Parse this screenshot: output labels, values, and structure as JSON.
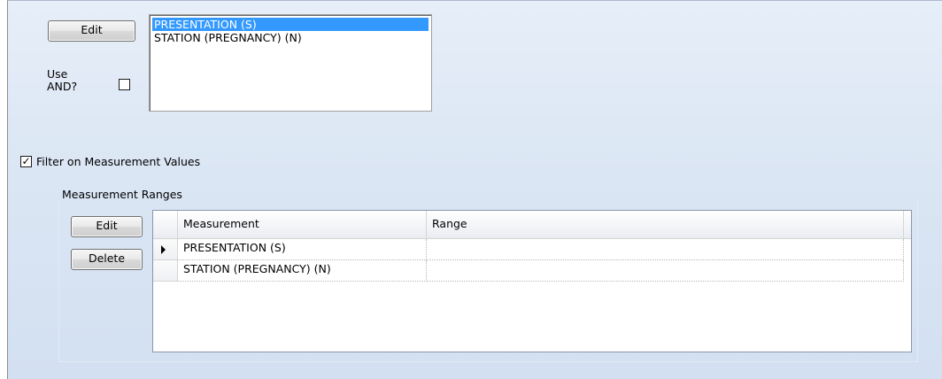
{
  "top_section": {
    "edit_label": "Edit",
    "use_and_label_line1": "Use",
    "use_and_label_line2": "AND?",
    "use_and_checked": false,
    "listbox_items": [
      {
        "label": "PRESENTATION (S)",
        "selected": true
      },
      {
        "label": "STATION (PREGNANCY) (N)",
        "selected": false
      }
    ]
  },
  "filter": {
    "label": "Filter on Measurement Values",
    "checked": true
  },
  "measurement_ranges": {
    "group_label": "Measurement Ranges",
    "edit_label": "Edit",
    "delete_label": "Delete",
    "columns": [
      "Measurement",
      "Range"
    ],
    "rows": [
      {
        "measurement": "PRESENTATION (S)",
        "range": "",
        "current": true
      },
      {
        "measurement": "STATION (PREGNANCY) (N)",
        "range": "",
        "current": false
      }
    ]
  },
  "colors": {
    "panel_background": "#dbe6f4",
    "selection": "#3399ff"
  }
}
